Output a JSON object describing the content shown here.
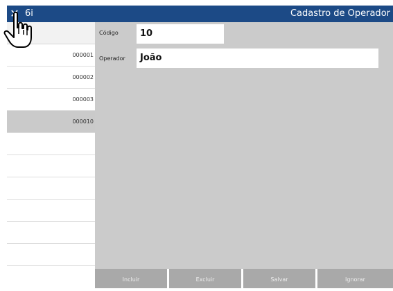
{
  "titlebar": {
    "close_glyph": "✕",
    "app_code": "6i",
    "title": "Cadastro de Operador"
  },
  "sidebar": {
    "rows": [
      {
        "code": "000001"
      },
      {
        "code": "000002"
      },
      {
        "code": "000003"
      },
      {
        "code": "000010"
      }
    ]
  },
  "form": {
    "codigo_label": "Código",
    "codigo_value": "10",
    "operador_label": "Operador",
    "operador_value": "João"
  },
  "footer": {
    "incluir": "Incluir",
    "excluir": "Excluir",
    "salvar": "Salvar",
    "ignorar": "Ignorar"
  },
  "colors": {
    "titlebar": "#1c4a86",
    "panel": "#cbcbcb",
    "button": "#a9a9a9",
    "selected_row": "#cacaca"
  },
  "icons": {
    "close": "close-icon",
    "cursor": "hand-pointer-icon"
  }
}
